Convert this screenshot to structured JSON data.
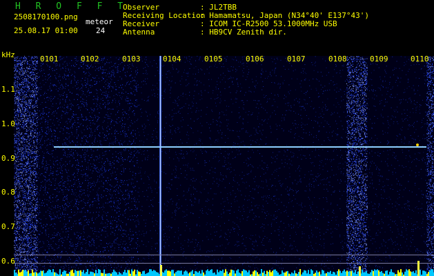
{
  "header": {
    "title": "H R O F F T",
    "filename": "2508170100.png",
    "datetime": "25.08.17 01:00",
    "meteor_label": "meteor",
    "meteor_count": "24"
  },
  "info": {
    "observer_label": "Observer",
    "observer_value": ": JL2TBB",
    "location_label": "Receiving Location",
    "location_value": ": Hamamatsu, Japan (N34°40' E137°43')",
    "receiver_label": "Receiver",
    "receiver_value": ": ICOM IC-R2500 53.1000MHz USB",
    "antenna_label": "Antenna",
    "antenna_value": ": HB9CV Zenith dir."
  },
  "axis": {
    "unit": "kHz",
    "y_ticks": [
      "1.1",
      "1.0",
      "0.9",
      "0.8",
      "0.7",
      "0.6"
    ],
    "time_ticks": [
      "0101",
      "0102",
      "0103",
      "0104",
      "0105",
      "0106",
      "0107",
      "0108",
      "0109",
      "0110"
    ]
  },
  "colors": {
    "background": "#000000",
    "labels": "#ffff00",
    "title": "#22c322",
    "noise": "#2040ff",
    "carrier": "#9ad8ff"
  }
}
